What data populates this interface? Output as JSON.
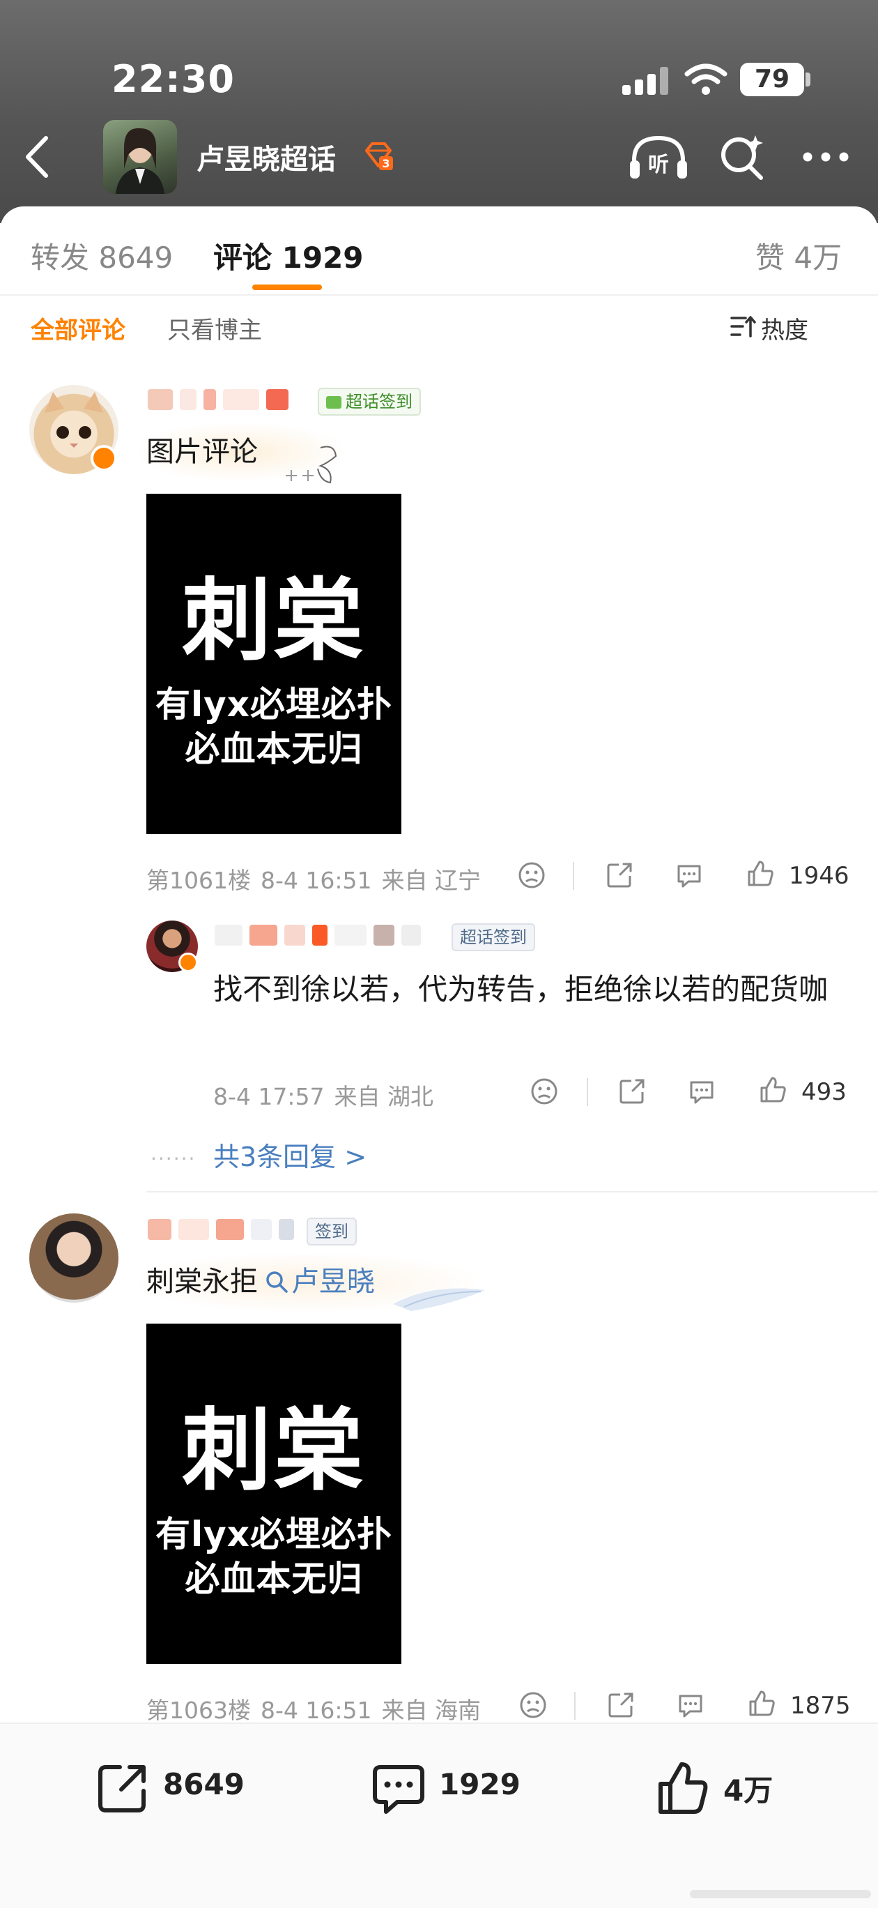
{
  "status_bar": {
    "time": "22:30",
    "battery": "79"
  },
  "header": {
    "title": "卢昱晓超话",
    "listen_label": "听"
  },
  "tabs": [
    {
      "label": "转发 8649"
    },
    {
      "label": "评论 1929"
    },
    {
      "label": "赞 4万"
    }
  ],
  "filters": {
    "all": "全部评论",
    "owner_only": "只看博主",
    "sort": "热度"
  },
  "comments": [
    {
      "tag": "超话签到",
      "text": "图片评论",
      "image": {
        "big": "刺棠",
        "line1": "有lyx必埋必扑",
        "line2": "必血本无归"
      },
      "floor": "第1061楼",
      "time": "8-4 16:51",
      "from": "来自 辽宁",
      "likes": "1946",
      "reply": {
        "tag": "超话签到",
        "text": "找不到徐以若，代为转告，拒绝徐以若的配货咖",
        "time": "8-4 17:57",
        "from": "来自 湖北",
        "likes": "493"
      },
      "more_replies": "共3条回复 >"
    },
    {
      "tag": "签到",
      "text": "刺棠永拒",
      "search_link": "卢昱晓",
      "image": {
        "big": "刺棠",
        "line1": "有lyx必埋必扑",
        "line2": "必血本无归"
      },
      "floor": "第1063楼",
      "time": "8-4 16:51",
      "from": "来自 海南",
      "likes": "1875"
    }
  ],
  "bottom_bar": {
    "reposts": "8649",
    "comments": "1929",
    "likes": "4万"
  },
  "colors": {
    "accent": "#ff8200",
    "link": "#4a7fbf"
  }
}
